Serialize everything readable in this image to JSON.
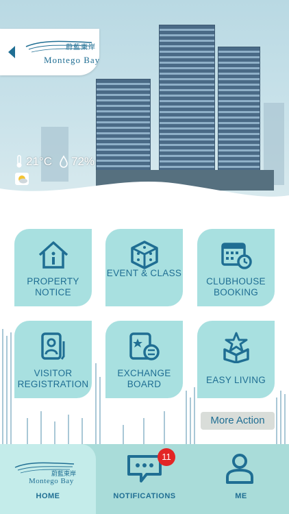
{
  "header": {
    "logo_cn": "蔚藍東岸",
    "logo_en": "Montego Bay",
    "temperature": "21°C",
    "humidity": "72%"
  },
  "tiles": [
    {
      "label_1": "PROPERTY",
      "label_2": "NOTICE",
      "icon": "house-info-icon"
    },
    {
      "label_1": "EVENT & CLASS",
      "label_2": "",
      "icon": "cube-icon"
    },
    {
      "label_1": "CLUBHOUSE",
      "label_2": "BOOKING",
      "icon": "calendar-clock-icon"
    },
    {
      "label_1": "VISITOR",
      "label_2": "REGISTRATION",
      "icon": "visitor-badge-icon"
    },
    {
      "label_1": "EXCHANGE",
      "label_2": "BOARD",
      "icon": "exchange-icon"
    },
    {
      "label_1": "EASY LIVING",
      "label_2": "",
      "icon": "star-box-icon"
    }
  ],
  "more_action": "More Action",
  "nav": {
    "home": "HOME",
    "home_logo_cn": "蔚藍東岸",
    "home_logo_en": "Montego Bay",
    "notifications": "NOTIFICATIONS",
    "badge": "11",
    "me": "ME"
  },
  "colors": {
    "accent": "#1f6e93",
    "tile": "#a8e0e0",
    "nav": "#a9dcd9",
    "badge": "#e32525"
  }
}
